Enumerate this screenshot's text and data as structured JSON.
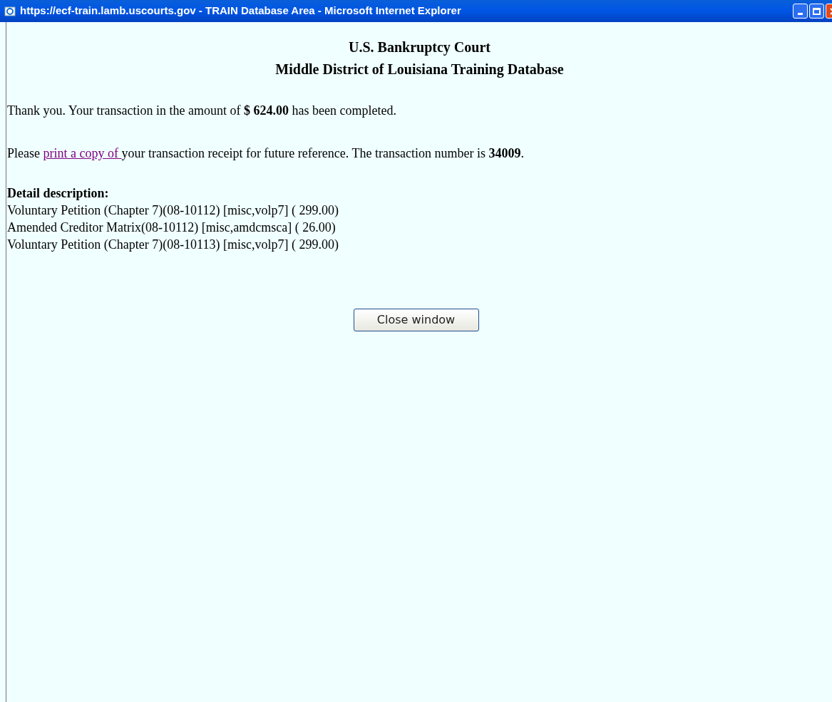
{
  "window": {
    "title": "https://ecf-train.lamb.uscourts.gov - TRAIN Database Area - Microsoft Internet Explorer"
  },
  "heading": [
    "U.S. Bankruptcy Court",
    "Middle District of Louisiana Training Database"
  ],
  "confirmation": "Thank you. Your transaction in the amount of **$ 624.00** has been completed.",
  "receipt": {
    "before": "Please",
    "link": "print a copy of",
    "after": "your transaction receipt for future reference. The transaction number is **34009**."
  },
  "detail": {
    "label": "Detail description:",
    "lines": [
      "Voluntary Petition (Chapter 7)(08-10112) [misc,volp7] ( 299.00)",
      "Amended Creditor Matrix(08-10112) [misc,amdcmsca] ( 26.00)",
      "Voluntary Petition (Chapter 7)(08-10113) [misc,volp7] ( 299.00)"
    ]
  },
  "button": "Close window"
}
